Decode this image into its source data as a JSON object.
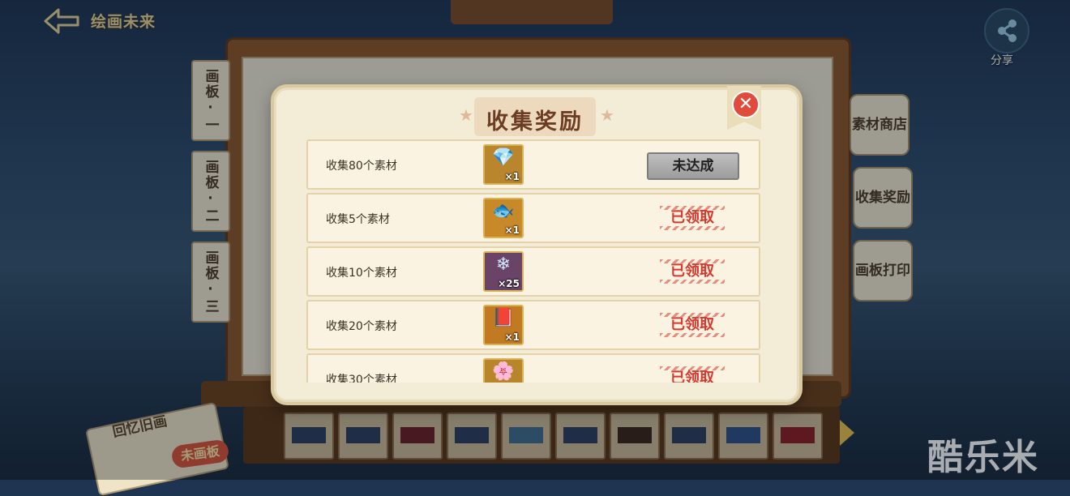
{
  "header": {
    "back_title": "绘画未来"
  },
  "share": {
    "label": "分享"
  },
  "side_tabs": [
    "画板·一",
    "画板·二",
    "画板·三"
  ],
  "right_tags": [
    "素材商店",
    "收集奖励",
    "画板打印"
  ],
  "bottom": {
    "card_title": "回忆旧画",
    "badge": "未画板"
  },
  "watermark": "酷乐米",
  "modal": {
    "title": "收集奖励",
    "close_label": "✕",
    "rows": [
      {
        "label": "收集80个素材",
        "icon": "gem-chest-icon",
        "glyph": "💎",
        "qty": "×1",
        "status": "未达成",
        "claimed": false,
        "icon_bg": "#b9862e"
      },
      {
        "label": "收集5个素材",
        "icon": "goldfish-icon",
        "glyph": "🐟",
        "qty": "×1",
        "status": "已领取",
        "claimed": true,
        "icon_bg": "#c88a28"
      },
      {
        "label": "收集10个素材",
        "icon": "crystal-shards-icon",
        "glyph": "❄",
        "qty": "×25",
        "status": "已领取",
        "claimed": true,
        "icon_bg": "#6a4468"
      },
      {
        "label": "收集20个素材",
        "icon": "mystery-book-icon",
        "glyph": "📕",
        "qty": "×1",
        "status": "已领取",
        "claimed": true,
        "icon_bg": "#c17a22"
      },
      {
        "label": "收集30个素材",
        "icon": "flower-gem-icon",
        "glyph": "🌸",
        "qty": "",
        "status": "已领取",
        "claimed": true,
        "icon_bg": "#b8852a"
      }
    ]
  }
}
